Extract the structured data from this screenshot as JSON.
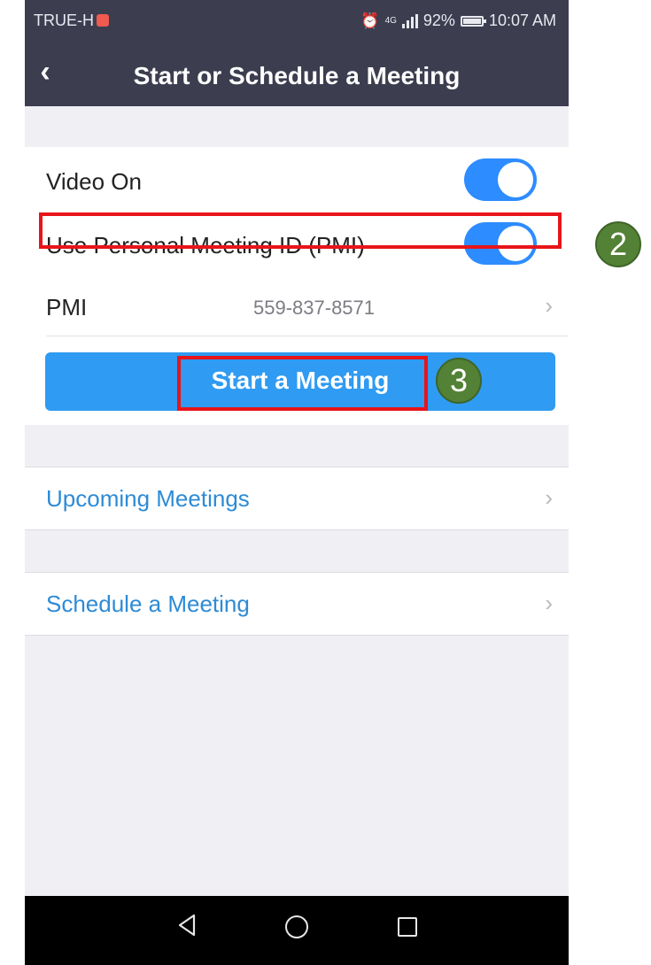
{
  "status_bar": {
    "carrier": "TRUE-H",
    "network": "4G",
    "battery": "92%",
    "time": "10:07 AM"
  },
  "header": {
    "back_icon": "chevron-left-icon",
    "title": "Start or Schedule a Meeting"
  },
  "settings": {
    "video_on": {
      "label": "Video On",
      "enabled": true
    },
    "use_pmi": {
      "label": "Use Personal Meeting ID (PMI)",
      "enabled": true
    },
    "pmi": {
      "label": "PMI",
      "value": "559-837-8571",
      "icon": "chevron-right-icon"
    }
  },
  "start_button": {
    "label": "Start a Meeting"
  },
  "links": {
    "upcoming": {
      "label": "Upcoming Meetings",
      "icon": "chevron-right-icon"
    },
    "schedule": {
      "label": "Schedule a Meeting",
      "icon": "chevron-right-icon"
    }
  },
  "nav_bar": {
    "back": "triangle-back-icon",
    "home": "circle-home-icon",
    "recent": "square-recent-icon"
  },
  "annotations": {
    "step_pmi": "2",
    "step_start": "3",
    "highlight_color": "#e8141a",
    "badge_color": "#538135"
  },
  "colors": {
    "header_bg": "#3c3d4f",
    "accent": "#2d8cff",
    "button": "#2f9bf2",
    "link": "#2d8bd6"
  }
}
